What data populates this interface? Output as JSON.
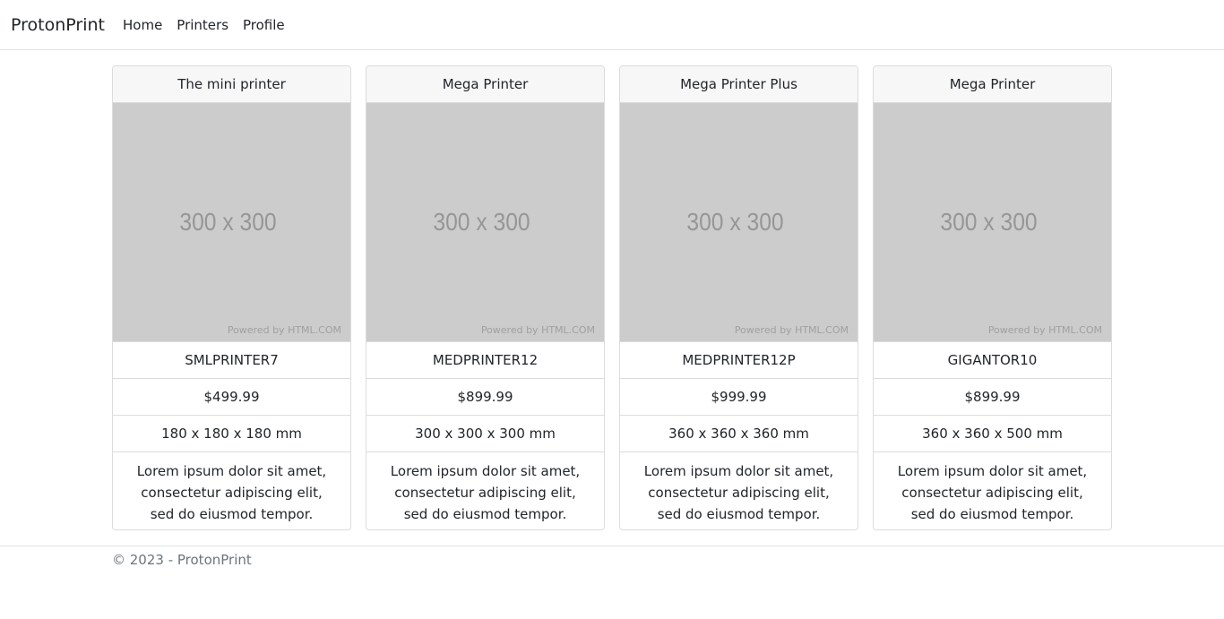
{
  "navbar": {
    "brand": "ProtonPrint",
    "links": [
      "Home",
      "Printers",
      "Profile"
    ]
  },
  "placeholder": {
    "size_text": "300 x 300",
    "powered_text": "Powered by HTML.COM"
  },
  "products": [
    {
      "name": "The mini printer",
      "sku": "SMLPRINTER7",
      "price": "$499.99",
      "dimensions": "180 x 180 x 180 mm",
      "description": "Lorem ipsum dolor sit amet, consectetur adipiscing elit, sed do eiusmod tempor."
    },
    {
      "name": "Mega Printer",
      "sku": "MEDPRINTER12",
      "price": "$899.99",
      "dimensions": "300 x 300 x 300 mm",
      "description": "Lorem ipsum dolor sit amet, consectetur adipiscing elit, sed do eiusmod tempor."
    },
    {
      "name": "Mega Printer Plus",
      "sku": "MEDPRINTER12P",
      "price": "$999.99",
      "dimensions": "360 x 360 x 360 mm",
      "description": "Lorem ipsum dolor sit amet, consectetur adipiscing elit, sed do eiusmod tempor."
    },
    {
      "name": "Mega Printer",
      "sku": "GIGANTOR10",
      "price": "$899.99",
      "dimensions": "360 x 360 x 500 mm",
      "description": "Lorem ipsum dolor sit amet, consectetur adipiscing elit, sed do eiusmod tempor."
    }
  ],
  "footer": {
    "text": "© 2023 - ProtonPrint"
  }
}
